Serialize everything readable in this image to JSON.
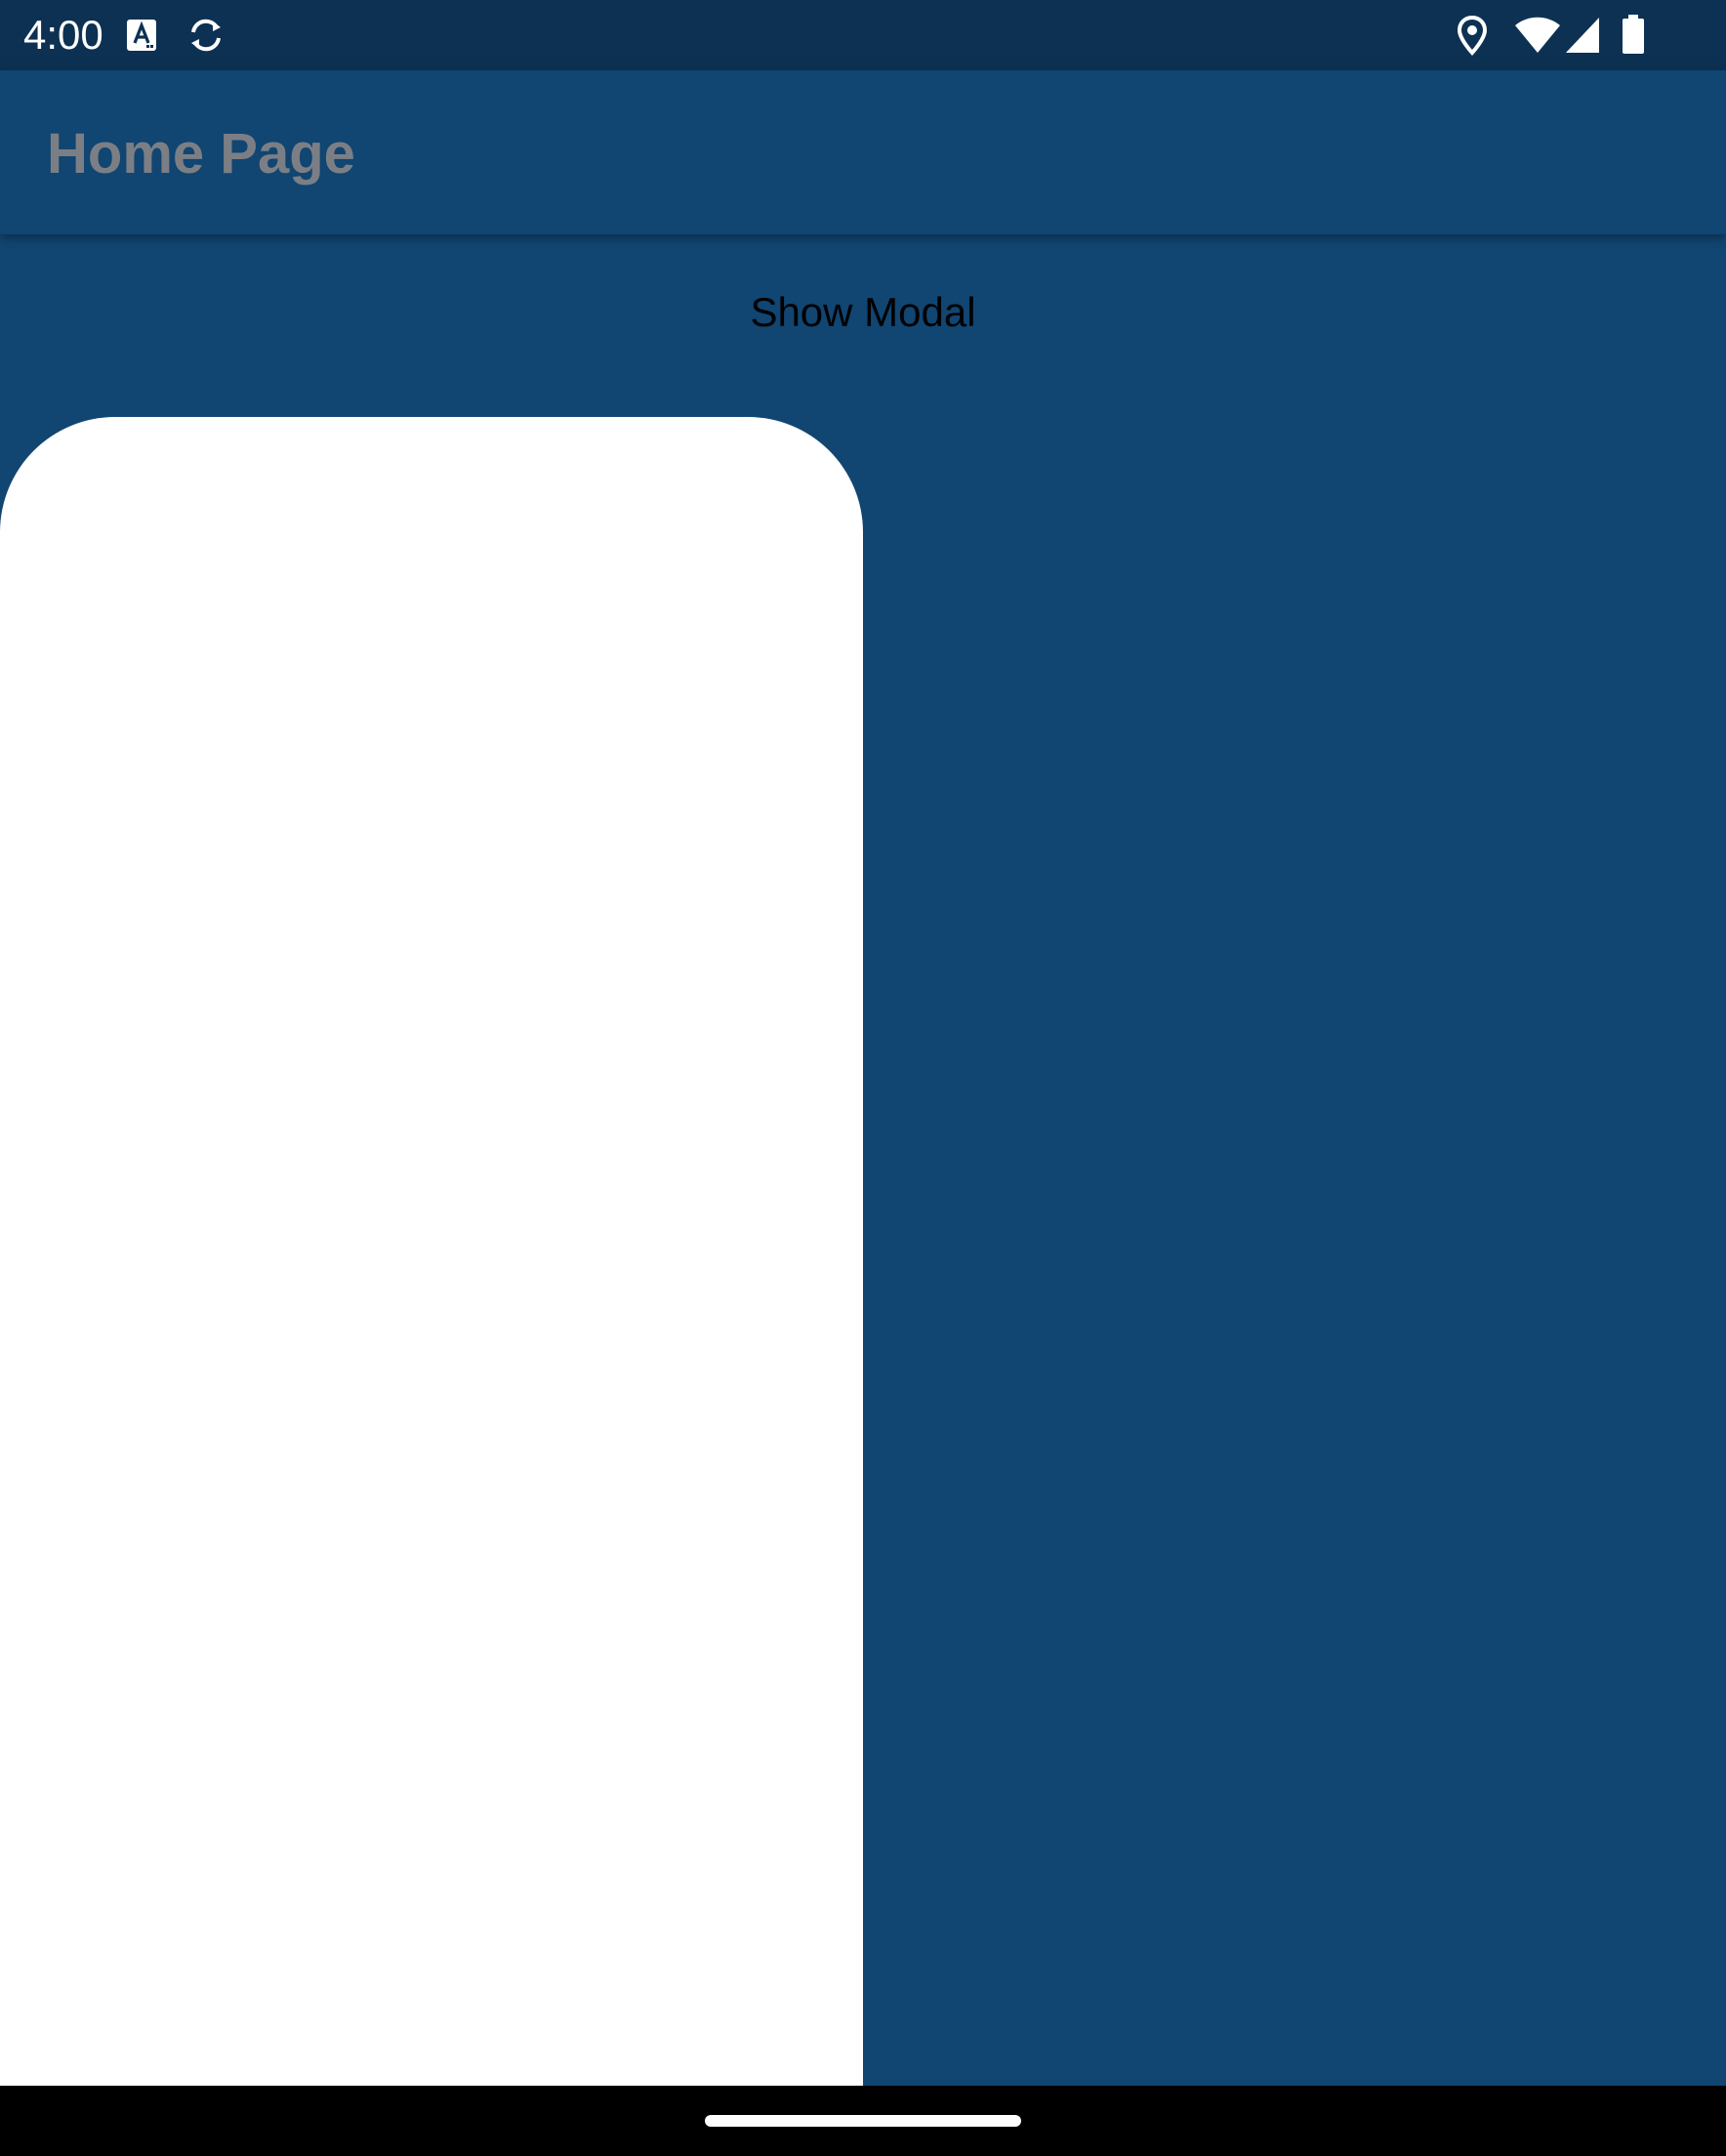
{
  "status_bar": {
    "time": "4:00",
    "left_icons": [
      "text-format-icon",
      "sync-icon"
    ],
    "right_icons": [
      "location-pin-icon",
      "wifi-icon",
      "cell-signal-icon",
      "battery-icon"
    ]
  },
  "app_bar": {
    "title": "Home Page"
  },
  "main": {
    "show_modal_label": "Show Modal"
  },
  "modal": {
    "color": "#ffffff"
  },
  "colors": {
    "background": "#114572",
    "status_bar": "#0d3153",
    "title_text": "#7b7f85",
    "nav_bar": "#000000"
  }
}
